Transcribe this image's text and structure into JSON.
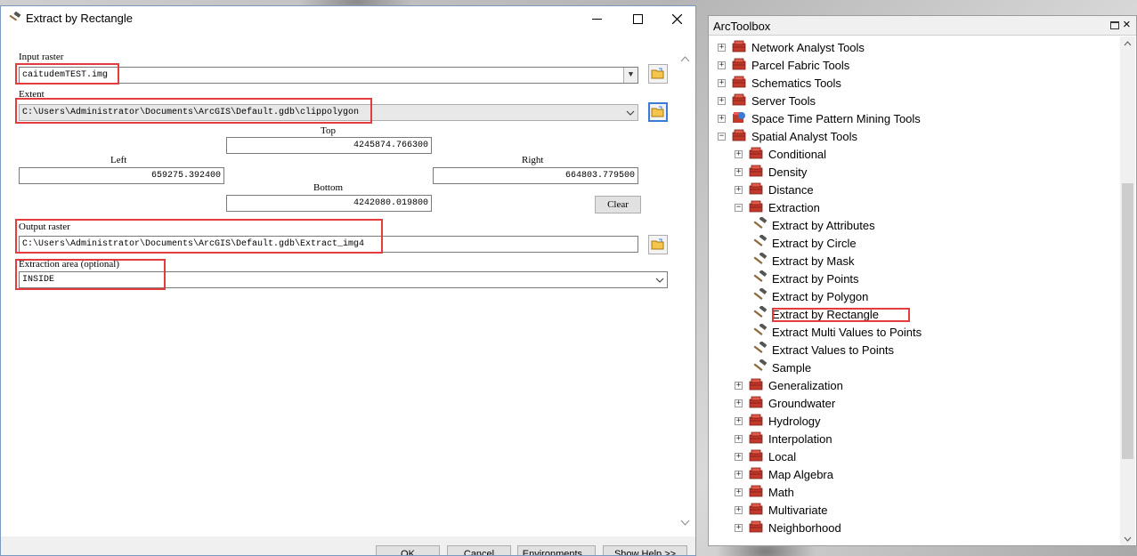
{
  "dialog": {
    "title": "Extract by Rectangle",
    "input_raster_label": "Input raster",
    "input_raster_value": "caitudemTEST.img",
    "extent_label": "Extent",
    "extent_value": "C:\\Users\\Administrator\\Documents\\ArcGIS\\Default.gdb\\clippolygon",
    "top_label": "Top",
    "top_value": "4245874.766300",
    "left_label": "Left",
    "left_value": "659275.392400",
    "right_label": "Right",
    "right_value": "664803.779500",
    "bottom_label": "Bottom",
    "bottom_value": "4242080.019800",
    "clear_label": "Clear",
    "output_raster_label": "Output raster",
    "output_raster_value": "C:\\Users\\Administrator\\Documents\\ArcGIS\\Default.gdb\\Extract_img4",
    "extraction_area_label": "Extraction area (optional)",
    "extraction_area_value": "INSIDE",
    "buttons": {
      "ok": "OK",
      "cancel": "Cancel",
      "environments": "Environments...",
      "show_help": "Show Help >>"
    }
  },
  "toolbox": {
    "title": "ArcToolbox",
    "items": [
      {
        "label": "Network Analyst Tools",
        "expander": "+"
      },
      {
        "label": "Parcel Fabric Tools",
        "expander": "+"
      },
      {
        "label": "Schematics Tools",
        "expander": "+"
      },
      {
        "label": "Server Tools",
        "expander": "+"
      },
      {
        "label": "Space Time Pattern Mining Tools",
        "expander": "+"
      },
      {
        "label": "Spatial Analyst Tools",
        "expander": "−"
      },
      {
        "label": "Conditional",
        "expander": "+"
      },
      {
        "label": "Density",
        "expander": "+"
      },
      {
        "label": "Distance",
        "expander": "+"
      },
      {
        "label": "Extraction",
        "expander": "−"
      },
      {
        "label": "Extract by Attributes"
      },
      {
        "label": "Extract by Circle"
      },
      {
        "label": "Extract by Mask"
      },
      {
        "label": "Extract by Points"
      },
      {
        "label": "Extract by Polygon"
      },
      {
        "label": "Extract by Rectangle"
      },
      {
        "label": "Extract Multi Values to Points"
      },
      {
        "label": "Extract Values to Points"
      },
      {
        "label": "Sample"
      },
      {
        "label": "Generalization",
        "expander": "+"
      },
      {
        "label": "Groundwater",
        "expander": "+"
      },
      {
        "label": "Hydrology",
        "expander": "+"
      },
      {
        "label": "Interpolation",
        "expander": "+"
      },
      {
        "label": "Local",
        "expander": "+"
      },
      {
        "label": "Map Algebra",
        "expander": "+"
      },
      {
        "label": "Math",
        "expander": "+"
      },
      {
        "label": "Multivariate",
        "expander": "+"
      },
      {
        "label": "Neighborhood",
        "expander": "+"
      }
    ]
  },
  "colors": {
    "highlight_red": "#e43c3c",
    "toolbox_icon_red": "#c0392b",
    "active_button_blue": "#3a7bd5"
  }
}
